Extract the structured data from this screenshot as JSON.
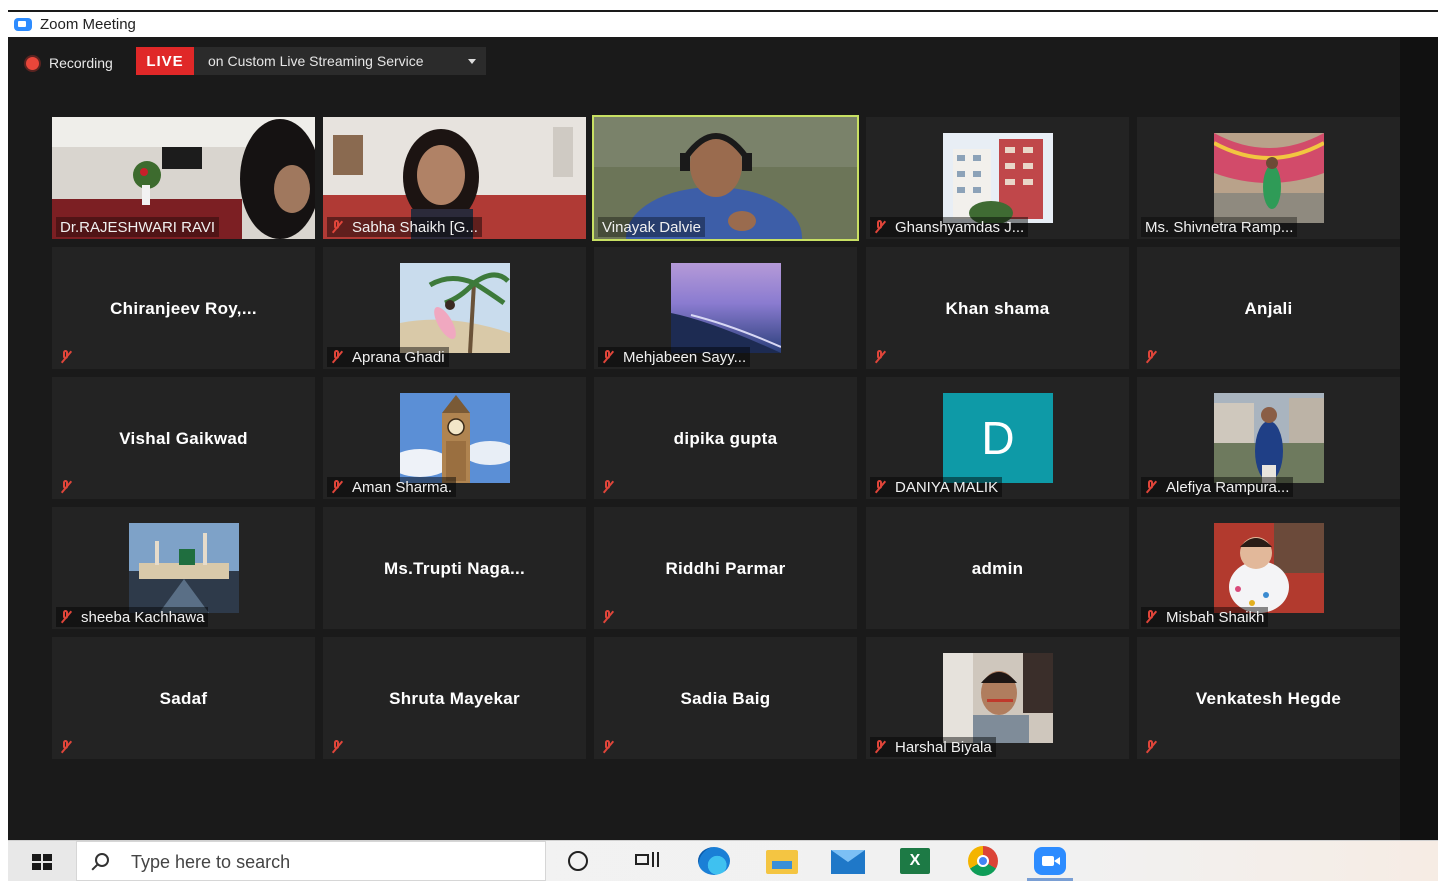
{
  "window": {
    "title": "Zoom Meeting"
  },
  "status": {
    "recording_label": "Recording",
    "live_label": "LIVE",
    "stream_label": "on Custom Live Streaming Service"
  },
  "participants": [
    {
      "name": "Dr.RAJESHWARI RAVI",
      "kind": "video",
      "muted": false
    },
    {
      "name": "Sabha Shaikh [G...",
      "kind": "video",
      "muted": true
    },
    {
      "name": "Vinayak Dalvie",
      "kind": "video",
      "muted": false,
      "active_speaker": true
    },
    {
      "name": "Ghanshyamdas J...",
      "kind": "photo",
      "muted": true
    },
    {
      "name": "Ms. Shivnetra Ramp...",
      "kind": "photo",
      "muted": false
    },
    {
      "name": "Chiranjeev  Roy,...",
      "kind": "name",
      "muted": true
    },
    {
      "name": "Aprana Ghadi",
      "kind": "photo",
      "muted": true
    },
    {
      "name": "Mehjabeen Sayy...",
      "kind": "photo",
      "muted": true
    },
    {
      "name": "Khan shama",
      "kind": "name",
      "muted": true
    },
    {
      "name": "Anjali",
      "kind": "name",
      "muted": true
    },
    {
      "name": "Vishal Gaikwad",
      "kind": "name",
      "muted": true
    },
    {
      "name": "Aman Sharma.",
      "kind": "photo",
      "muted": true
    },
    {
      "name": "dipika gupta",
      "kind": "name",
      "muted": true
    },
    {
      "name": "DANIYA MALIK",
      "kind": "initial",
      "initial": "D",
      "muted": true
    },
    {
      "name": "Alefiya Rampura...",
      "kind": "photo",
      "muted": true
    },
    {
      "name": "sheeba Kachhawa",
      "kind": "photo",
      "muted": true
    },
    {
      "name": "Ms.Trupti  Naga...",
      "kind": "name",
      "muted": false
    },
    {
      "name": "Riddhi Parmar",
      "kind": "name",
      "muted": true
    },
    {
      "name": "admin",
      "kind": "name",
      "muted": false
    },
    {
      "name": "Misbah Shaikh",
      "kind": "photo",
      "muted": true
    },
    {
      "name": "Sadaf",
      "kind": "name",
      "muted": true
    },
    {
      "name": "Shruta Mayekar",
      "kind": "name",
      "muted": true
    },
    {
      "name": "Sadia Baig",
      "kind": "name",
      "muted": true
    },
    {
      "name": "Harshal Biyala",
      "kind": "photo",
      "muted": true
    },
    {
      "name": "Venkatesh  Hegde",
      "kind": "name",
      "muted": true
    }
  ],
  "taskbar": {
    "search_placeholder": "Type here to search",
    "excel_letter": "X"
  },
  "colors": {
    "live": "#e02828",
    "active_speaker_border": "#c8e063",
    "muted_icon": "#e0453a",
    "avatar_teal": "#0e9aa7"
  }
}
